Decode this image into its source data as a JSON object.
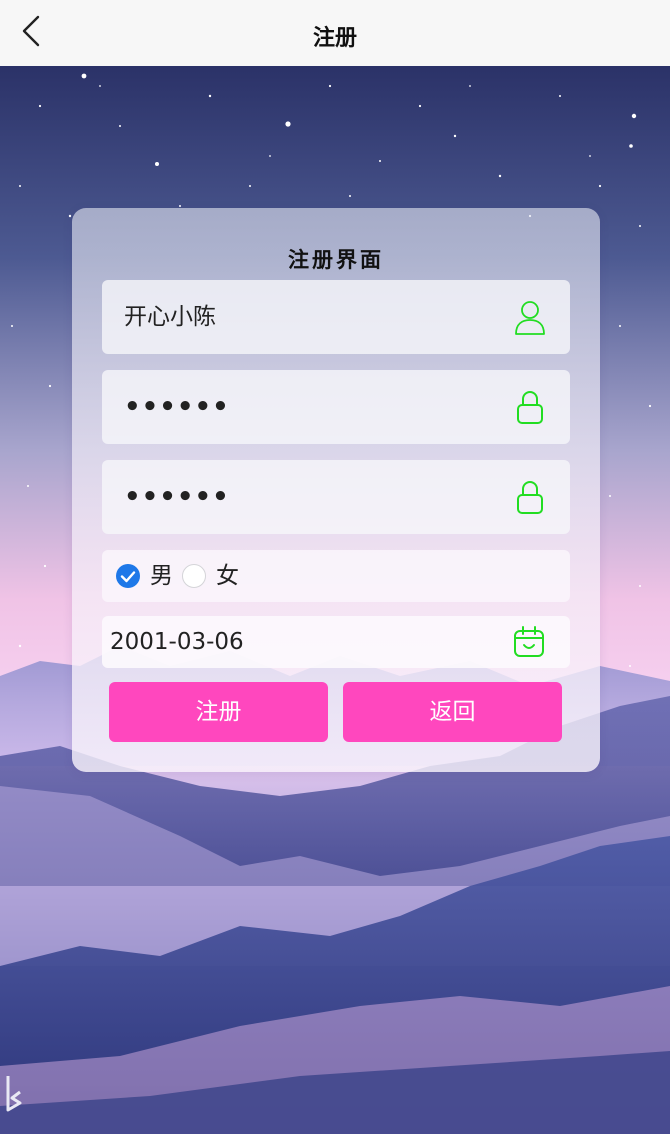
{
  "navbar": {
    "title": "注册",
    "back_icon": "chevron-left-icon"
  },
  "form": {
    "title": "注册界面",
    "username": {
      "value": "开心小陈",
      "icon": "user-icon"
    },
    "password": {
      "value": "••••••",
      "icon": "lock-icon"
    },
    "confirm_password": {
      "value": "••••••",
      "icon": "lock-icon"
    },
    "gender": {
      "options": [
        {
          "label": "男",
          "checked": true
        },
        {
          "label": "女",
          "checked": false
        }
      ]
    },
    "birthday": {
      "value": "2001-03-06",
      "icon": "calendar-icon"
    },
    "buttons": {
      "register": "注册",
      "back": "返回"
    }
  },
  "colors": {
    "accent_icon": "#22dd22",
    "button": "#ff47be",
    "radio_checked": "#1e78e8"
  }
}
